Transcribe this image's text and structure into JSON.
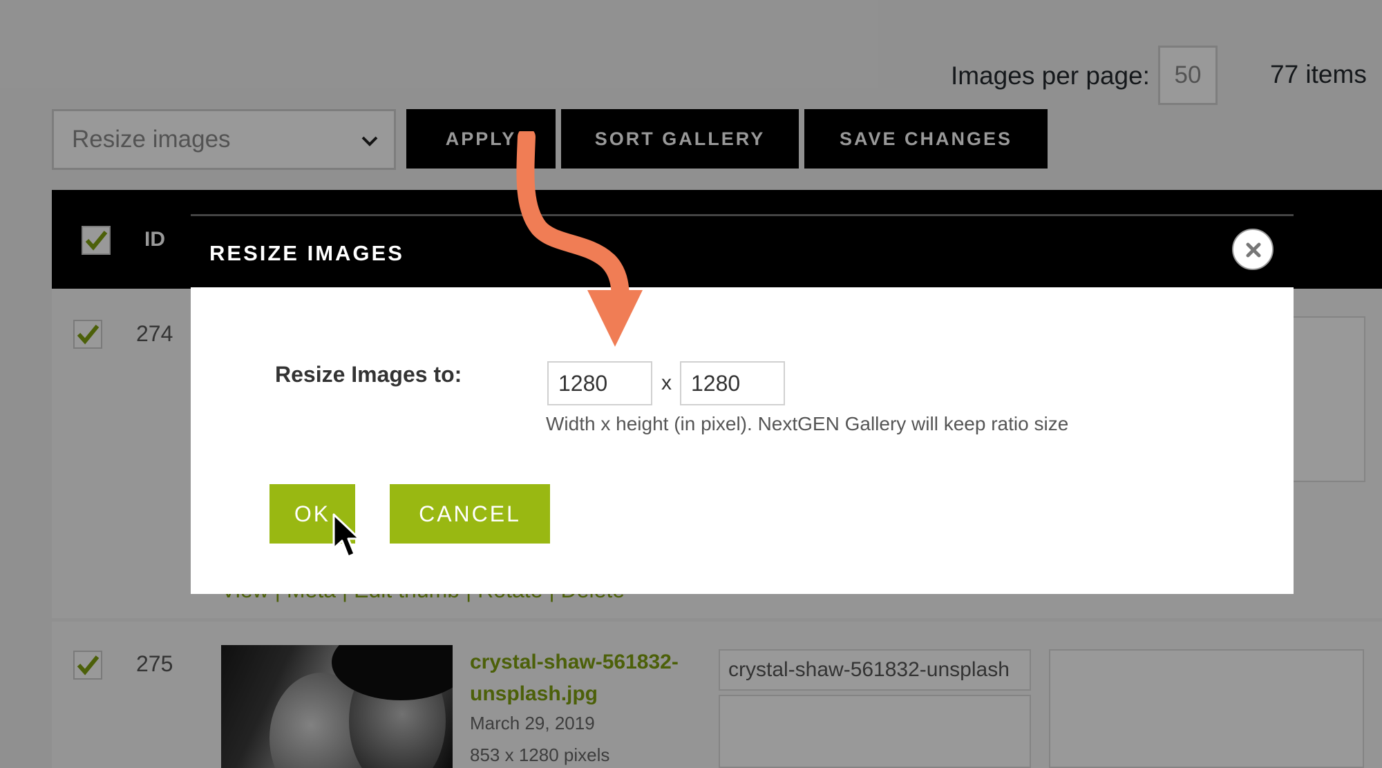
{
  "pagination": {
    "images_per_page_label": "Images per page:",
    "images_per_page_value": "50",
    "items_count": "77 items"
  },
  "toolbar": {
    "bulk_action_selected": "Resize images",
    "apply_label": "APPLY",
    "sort_label": "SORT GALLERY",
    "save_label": "SAVE CHANGES"
  },
  "table": {
    "header_id": "ID",
    "rows": [
      {
        "id": "274",
        "actions": "View | Meta | Edit thumb | Rotate | Delete"
      },
      {
        "id": "275",
        "filename": "crystal-shaw-561832-unsplash.jpg",
        "date": "March 29, 2019",
        "dimensions": "853 x 1280 pixels",
        "alt_text": "crystal-shaw-561832-unsplash"
      }
    ]
  },
  "modal": {
    "title": "RESIZE IMAGES",
    "resize_label": "Resize Images to:",
    "width_value": "1280",
    "height_value": "1280",
    "times": "x",
    "hint": "Width x height (in pixel). NextGEN Gallery will keep ratio size",
    "ok_label": "OK",
    "cancel_label": "CANCEL"
  },
  "colors": {
    "accent_green": "#99b812",
    "link_green": "#7fa00f",
    "arrow_orange": "#f07d55"
  },
  "icons": [
    "chevron-down-icon",
    "checkmark-icon",
    "close-icon",
    "annotation-arrow-icon",
    "mouse-cursor-icon"
  ]
}
